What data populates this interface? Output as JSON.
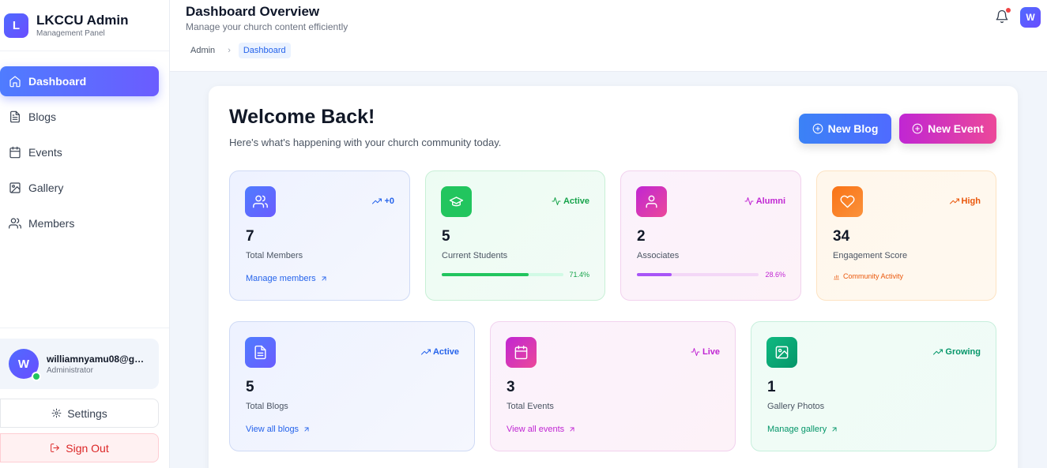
{
  "brand": {
    "logo_letter": "L",
    "title": "LKCCU Admin",
    "subtitle": "Management Panel"
  },
  "sidebar": {
    "items": [
      {
        "label": "Dashboard",
        "icon": "home-icon",
        "active": true
      },
      {
        "label": "Blogs",
        "icon": "file-text-icon"
      },
      {
        "label": "Events",
        "icon": "calendar-icon"
      },
      {
        "label": "Gallery",
        "icon": "image-icon"
      },
      {
        "label": "Members",
        "icon": "users-icon"
      }
    ],
    "user": {
      "initial": "W",
      "email": "williamnyamu08@gmail.com",
      "role": "Administrator"
    },
    "settings_label": "Settings",
    "signout_label": "Sign Out"
  },
  "header": {
    "title": "Dashboard Overview",
    "subtitle": "Manage your church content efficiently",
    "breadcrumb": [
      "Admin",
      "Dashboard"
    ],
    "avatar_initial": "W"
  },
  "main": {
    "welcome_title": "Welcome Back!",
    "welcome_subtitle": "Here's what's happening with your church community today.",
    "new_blog_label": "New Blog",
    "new_event_label": "New Event",
    "stats": [
      {
        "value": "7",
        "label": "Total Members",
        "tag": "+0",
        "link": "Manage members",
        "color": "#4f6bff"
      },
      {
        "value": "5",
        "label": "Current Students",
        "tag": "Active",
        "progress": 0.714,
        "progress_label": "71.4%",
        "color": "#16a34a"
      },
      {
        "value": "2",
        "label": "Associates",
        "tag": "Alumni",
        "progress": 0.286,
        "progress_label": "28.6%",
        "color": "#c026d3"
      },
      {
        "value": "34",
        "label": "Engagement Score",
        "tag": "High",
        "activity": "Community Activity",
        "color": "#ea580c"
      }
    ],
    "content": [
      {
        "value": "5",
        "label": "Total Blogs",
        "tag": "Active",
        "link": "View all blogs",
        "color": "#2563eb"
      },
      {
        "value": "3",
        "label": "Total Events",
        "tag": "Live",
        "link": "View all events",
        "color": "#c026d3"
      },
      {
        "value": "1",
        "label": "Gallery Photos",
        "tag": "Growing",
        "link": "Manage gallery",
        "color": "#059669"
      }
    ]
  }
}
